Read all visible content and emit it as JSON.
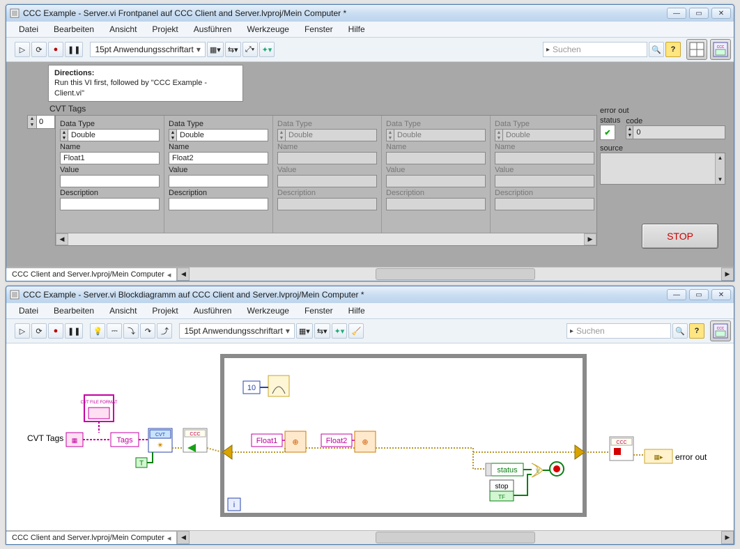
{
  "front": {
    "title": "CCC Example - Server.vi Frontpanel auf CCC Client and Server.lvproj/Mein Computer *",
    "menu": [
      "Datei",
      "Bearbeiten",
      "Ansicht",
      "Projekt",
      "Ausführen",
      "Werkzeuge",
      "Fenster",
      "Hilfe"
    ],
    "font_label": "15pt Anwendungsschriftart",
    "search_placeholder": "Suchen",
    "directions_head": "Directions:",
    "directions_body": "Run this VI first, followed by \"CCC Example - Client.vi\"",
    "cvt_label": "CVT Tags",
    "index_value": "0",
    "labels": {
      "datatype": "Data Type",
      "name": "Name",
      "value": "Value",
      "description": "Description"
    },
    "tags": [
      {
        "active": true,
        "datatype": "Double",
        "name": "Float1",
        "value": "",
        "description": ""
      },
      {
        "active": true,
        "datatype": "Double",
        "name": "Float2",
        "value": "",
        "description": ""
      },
      {
        "active": false,
        "datatype": "Double",
        "name": "",
        "value": "",
        "description": ""
      },
      {
        "active": false,
        "datatype": "Double",
        "name": "",
        "value": "",
        "description": ""
      },
      {
        "active": false,
        "datatype": "Double",
        "name": "",
        "value": "",
        "description": ""
      }
    ],
    "error_out": {
      "label": "error out",
      "status_label": "status",
      "status_ok": true,
      "code_label": "code",
      "code_value": "0",
      "source_label": "source",
      "source_value": ""
    },
    "stop_label": "STOP",
    "project_path": "CCC Client and Server.lvproj/Mein Computer"
  },
  "bd": {
    "title": "CCC Example - Server.vi Blockdiagramm auf CCC Client and Server.lvproj/Mein Computer *",
    "menu": [
      "Datei",
      "Bearbeiten",
      "Ansicht",
      "Projekt",
      "Ausführen",
      "Werkzeuge",
      "Fenster",
      "Hilfe"
    ],
    "font_label": "15pt Anwendungsschriftart",
    "search_placeholder": "Suchen",
    "project_path": "CCC Client and Server.lvproj/Mein Computer",
    "nodes": {
      "cvt_tags_ctrl": "CVT Tags",
      "tags_label": "Tags",
      "loop_timer": "10",
      "float1": "Float1",
      "float2": "Float2",
      "status": "status",
      "stop": "stop",
      "tf": "TF",
      "error_out": "error out",
      "iter": "i",
      "true_const": "T",
      "cvt_file": "CVT FILE FORMAT",
      "ccc": "CCC",
      "cvt_init": "CVT"
    }
  }
}
